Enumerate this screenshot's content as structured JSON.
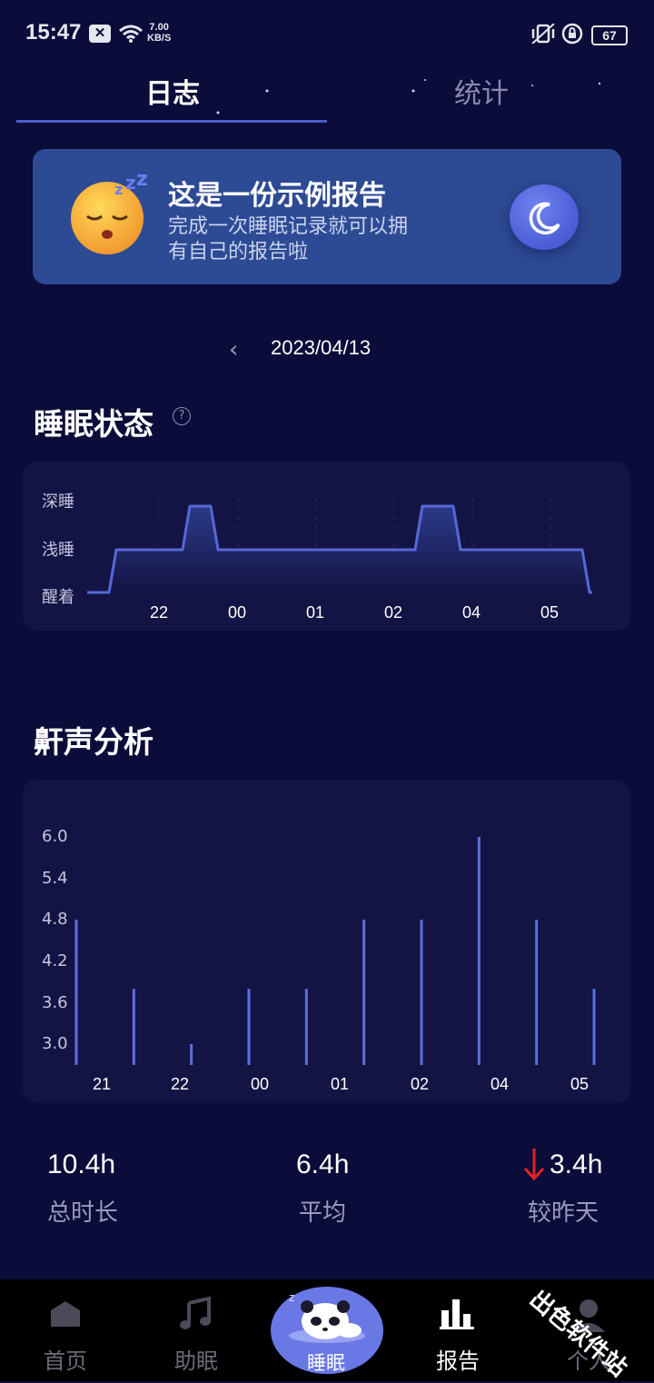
{
  "status_bar": {
    "time": "15:47",
    "speed_value": "7.00",
    "speed_unit": "KB/S",
    "battery": "67"
  },
  "tabs": [
    {
      "label": "日志",
      "active": true
    },
    {
      "label": "统计",
      "active": false
    }
  ],
  "banner": {
    "title": "这是一份示例报告",
    "subtitle_line1": "完成一次睡眠记录就可以拥",
    "subtitle_line2": "有自己的报告啦"
  },
  "date": "2023/04/13",
  "sleep_state": {
    "title": "睡眠状态",
    "help": "?",
    "levels": [
      "深睡",
      "浅睡",
      "醒着"
    ],
    "x_ticks": [
      "22",
      "00",
      "01",
      "02",
      "04",
      "05"
    ]
  },
  "snore": {
    "title": "鼾声分析",
    "y_ticks": [
      "6.0",
      "5.4",
      "4.8",
      "4.2",
      "3.6",
      "3.0"
    ],
    "x_ticks": [
      "21",
      "22",
      "00",
      "01",
      "02",
      "04",
      "05"
    ]
  },
  "chart_data": [
    {
      "type": "area",
      "categories": [
        "22",
        "00",
        "01",
        "02",
        "04",
        "05"
      ],
      "levels": [
        "醒着",
        "浅睡",
        "深睡"
      ],
      "series": [
        {
          "values": [
            "醒着",
            "浅睡",
            "深睡",
            "浅睡",
            "浅睡",
            "浅睡",
            "深睡",
            "浅睡",
            "浅睡",
            "醒着"
          ]
        }
      ]
    },
    {
      "type": "bar",
      "x_ticks": [
        "21",
        "22",
        "00",
        "01",
        "02",
        "04",
        "05"
      ],
      "values": [
        4.8,
        3.8,
        3.0,
        3.8,
        3.8,
        4.8,
        4.8,
        6.0,
        4.8,
        3.8
      ],
      "ylim": [
        3.0,
        6.0
      ]
    }
  ],
  "stats": [
    {
      "value": "10.4h",
      "label": "总时长"
    },
    {
      "value": "6.4h",
      "label": "平均"
    },
    {
      "value": "3.4h",
      "label": "较昨天",
      "trend": "down",
      "trend_color": "#e02424"
    }
  ],
  "nav": [
    {
      "label": "首页",
      "icon": "home-icon"
    },
    {
      "label": "助眠",
      "icon": "music-note-icon"
    },
    {
      "label": "睡眠",
      "icon": "sleeping-panda-icon",
      "active": true
    },
    {
      "label": "报告",
      "icon": "bar-chart-icon"
    },
    {
      "label": "个人",
      "icon": "person-icon"
    }
  ],
  "watermark": "出色软件站",
  "colors": {
    "background": "#0c0c3a",
    "card": "#141444",
    "accent": "#4a5ec8",
    "banner": "#2d4a94"
  }
}
